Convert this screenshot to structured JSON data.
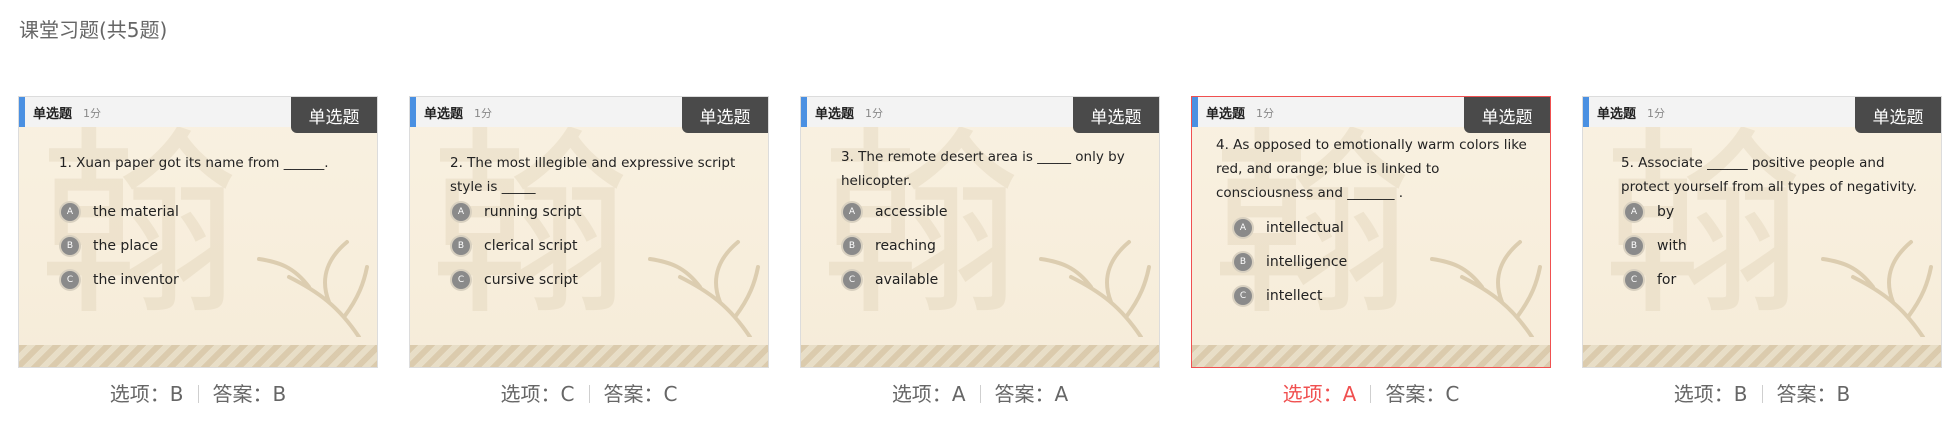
{
  "page": {
    "title": "课堂习题(共5题)"
  },
  "labels": {
    "choice_prefix": "选项：",
    "answer_prefix": "答案："
  },
  "cards": [
    {
      "type": "单选题",
      "score": "1分",
      "badge": "单选题",
      "question": "1. Xuan paper got its name from ______.",
      "options": [
        {
          "letter": "A",
          "text": "the material"
        },
        {
          "letter": "B",
          "text": "the place"
        },
        {
          "letter": "C",
          "text": "the inventor"
        }
      ],
      "choice": "B",
      "answer": "B"
    },
    {
      "type": "单选题",
      "score": "1分",
      "badge": "单选题",
      "question": "2. The most illegible and expressive script style is _____",
      "options": [
        {
          "letter": "A",
          "text": "running script"
        },
        {
          "letter": "B",
          "text": "clerical script"
        },
        {
          "letter": "C",
          "text": "cursive script"
        }
      ],
      "choice": "C",
      "answer": "C"
    },
    {
      "type": "单选题",
      "score": "1分",
      "badge": "单选题",
      "question": "3. The remote desert area is _____ only by helicopter.",
      "options": [
        {
          "letter": "A",
          "text": "accessible"
        },
        {
          "letter": "B",
          "text": "reaching"
        },
        {
          "letter": "C",
          "text": "available"
        }
      ],
      "choice": "A",
      "answer": "A"
    },
    {
      "type": "单选题",
      "score": "1分",
      "badge": "单选题",
      "question": "4. As opposed to emotionally warm colors like red, and orange; blue is linked to consciousness and _______ .",
      "options": [
        {
          "letter": "A",
          "text": "intellectual"
        },
        {
          "letter": "B",
          "text": "intelligence"
        },
        {
          "letter": "C",
          "text": "intellect"
        }
      ],
      "choice": "A",
      "answer": "C"
    },
    {
      "type": "单选题",
      "score": "1分",
      "badge": "单选题",
      "question": "5. Associate ______ positive people and protect yourself from all types of negativity.",
      "options": [
        {
          "letter": "A",
          "text": "by"
        },
        {
          "letter": "B",
          "text": "with"
        },
        {
          "letter": "C",
          "text": "for"
        }
      ],
      "choice": "B",
      "answer": "B"
    }
  ]
}
